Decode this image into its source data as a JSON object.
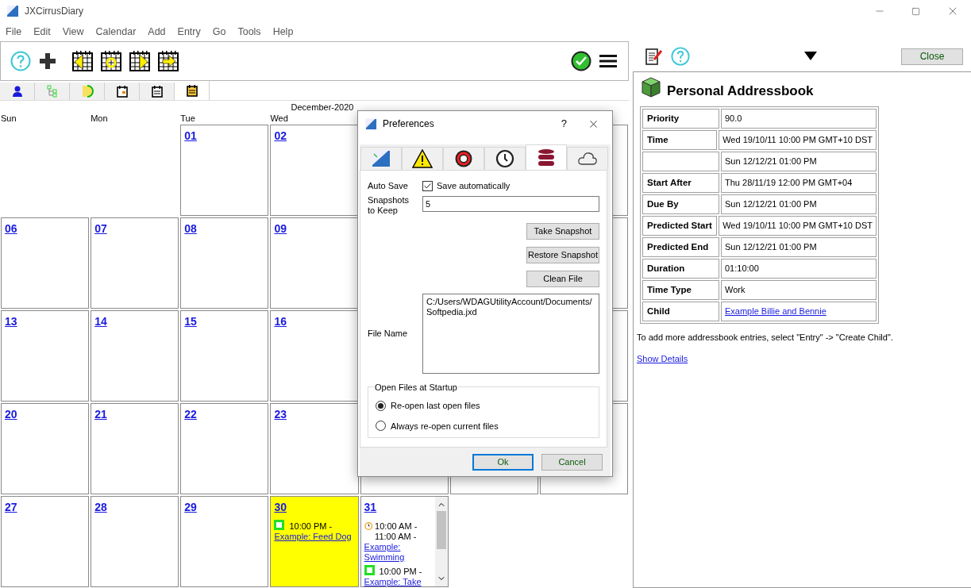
{
  "window": {
    "title": "JXCirrusDiary"
  },
  "menu": [
    "File",
    "Edit",
    "View",
    "Calendar",
    "Add",
    "Entry",
    "Go",
    "Tools",
    "Help"
  ],
  "view_tabs": [
    {
      "selected": false
    },
    {
      "selected": false
    },
    {
      "selected": false
    },
    {
      "selected": false
    },
    {
      "selected": false
    },
    {
      "selected": true
    }
  ],
  "calendar": {
    "month": "December-2020",
    "weekdays": [
      "Sun",
      "Mon",
      "Tue",
      "Wed"
    ],
    "weeks": [
      [
        {
          "kind": "blank"
        },
        {
          "kind": "blank"
        },
        {
          "kind": "day",
          "day": "01"
        },
        {
          "kind": "day",
          "day": "02"
        },
        {
          "kind": "covered"
        },
        {
          "kind": "covered"
        },
        {
          "kind": "day"
        }
      ],
      [
        {
          "kind": "day",
          "day": "06"
        },
        {
          "kind": "day",
          "day": "07"
        },
        {
          "kind": "day",
          "day": "08"
        },
        {
          "kind": "day",
          "day": "09"
        },
        {
          "kind": "covered"
        },
        {
          "kind": "covered"
        },
        {
          "kind": "day"
        }
      ],
      [
        {
          "kind": "day",
          "day": "13"
        },
        {
          "kind": "day",
          "day": "14"
        },
        {
          "kind": "day",
          "day": "15"
        },
        {
          "kind": "day",
          "day": "16"
        },
        {
          "kind": "covered"
        },
        {
          "kind": "covered"
        },
        {
          "kind": "day"
        }
      ],
      [
        {
          "kind": "day",
          "day": "20"
        },
        {
          "kind": "day",
          "day": "21"
        },
        {
          "kind": "day",
          "day": "22"
        },
        {
          "kind": "day",
          "day": "23"
        },
        {
          "kind": "day"
        },
        {
          "kind": "day"
        },
        {
          "kind": "day"
        }
      ],
      [
        {
          "kind": "day",
          "day": "27"
        },
        {
          "kind": "day",
          "day": "28"
        },
        {
          "kind": "day",
          "day": "29"
        },
        {
          "kind": "day",
          "day": "30",
          "highlighted": true,
          "events": [
            {
              "kind": "task",
              "time": "10:00 PM -",
              "link": "Example: Feed Dog"
            }
          ]
        },
        {
          "kind": "day",
          "day": "31",
          "scrollable": true,
          "events": [
            {
              "kind": "appointment",
              "time": "10:00 AM - 11:00 AM -",
              "link": "Example: Swimming"
            },
            {
              "kind": "task",
              "time": "10:00 PM -",
              "link": "Example: Take"
            }
          ]
        },
        {
          "kind": "blank"
        },
        {
          "kind": "blank"
        }
      ]
    ]
  },
  "dialog": {
    "title": "Preferences",
    "help": "?",
    "tabs": [
      {
        "selected": false
      },
      {
        "selected": false
      },
      {
        "selected": false
      },
      {
        "selected": false
      },
      {
        "selected": true
      },
      {
        "selected": false
      }
    ],
    "auto_save": {
      "label": "Auto Save",
      "checkbox": "Save automatically",
      "checked": true
    },
    "snapshots": {
      "label": "Snapshots to Keep",
      "value": "5"
    },
    "actions": [
      "Take Snapshot",
      "Restore Snapshot",
      "Clean File"
    ],
    "file_name": {
      "label": "File Name",
      "value": "C:/Users/WDAGUtilityAccount/Documents/Softpedia.jxd"
    },
    "startup": {
      "legend": "Open Files at Startup",
      "options": [
        {
          "label": "Re-open last open files",
          "selected": true
        },
        {
          "label": "Always re-open current files",
          "selected": false
        }
      ]
    },
    "buttons": [
      {
        "label": "Ok",
        "default": true
      },
      {
        "label": "Cancel",
        "default": false
      }
    ]
  },
  "detail": {
    "close": "Close",
    "title": "Personal Addressbook",
    "rows": [
      {
        "label": "Priority",
        "value": "90.0"
      },
      {
        "label": "Time",
        "value": "Wed 19/10/11 10:00 PM GMT+10 DST"
      },
      {
        "value": "Sun 12/12/21 01:00 PM"
      },
      {
        "label": "Start After",
        "value": "Thu 28/11/19 12:00 PM GMT+04"
      },
      {
        "label": "Due By",
        "value": "Sun 12/12/21 01:00 PM"
      },
      {
        "label": "Predicted Start",
        "value": "Wed 19/10/11 10:00 PM GMT+10 DST"
      },
      {
        "label": "Predicted End",
        "value": "Sun 12/12/21 01:00 PM"
      },
      {
        "label": "Duration",
        "value": "01:10:00"
      },
      {
        "label": "Time Type",
        "value": "Work"
      },
      {
        "label": "Child",
        "value": "Example Billie and Bennie",
        "kind": "link"
      }
    ],
    "note": "To add more addressbook entries, select \"Entry\" -> \"Create Child\".",
    "details_link": "Show Details"
  }
}
